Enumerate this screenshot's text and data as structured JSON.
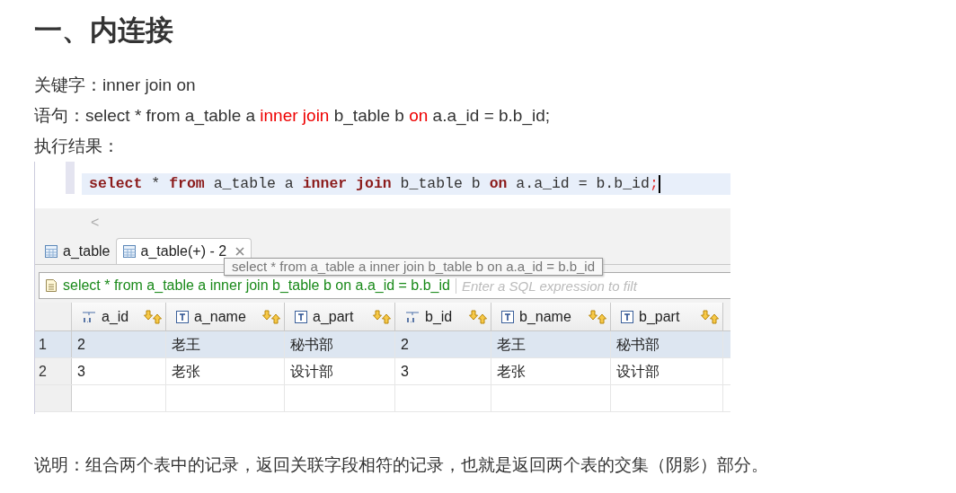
{
  "heading": "一、内连接",
  "keyword_line": {
    "label": "关键字：",
    "value": "inner join on"
  },
  "statement_line": {
    "label": "语句：",
    "segments": [
      {
        "text": "select * from a_table a ",
        "highlight": false
      },
      {
        "text": "inner join",
        "highlight": true
      },
      {
        "text": " b_table b ",
        "highlight": false
      },
      {
        "text": "on",
        "highlight": true
      },
      {
        "text": " a.a_id = b.b_id;",
        "highlight": false
      }
    ]
  },
  "result_label": "执行结果：",
  "editor": {
    "tokens": [
      {
        "text": "select",
        "kind": "keyword"
      },
      {
        "text": " * ",
        "kind": "plain"
      },
      {
        "text": "from",
        "kind": "keyword"
      },
      {
        "text": " a_table a ",
        "kind": "plain"
      },
      {
        "text": "inner join",
        "kind": "keyword"
      },
      {
        "text": " b_table b ",
        "kind": "plain"
      },
      {
        "text": "on",
        "kind": "keyword"
      },
      {
        "text": " a.a_id = b.b_id",
        "kind": "plain"
      },
      {
        "text": ";",
        "kind": "punct"
      }
    ],
    "scroll_arrow": "<"
  },
  "tabs": [
    {
      "label": "a_table",
      "selected": false,
      "closable": false
    },
    {
      "label": "a_table(+) - 2",
      "selected": true,
      "closable": true
    }
  ],
  "tooltip": "select * from a_table a inner join b_table b on a.a_id = b.b_id",
  "filter": {
    "value": "select * from a_table a inner join b_table b on a.a_id = b.b_id",
    "placeholder": "Enter a SQL expression to filt"
  },
  "table": {
    "columns": [
      {
        "name": "a_id",
        "kind": "number"
      },
      {
        "name": "a_name",
        "kind": "text"
      },
      {
        "name": "a_part",
        "kind": "text"
      },
      {
        "name": "b_id",
        "kind": "number"
      },
      {
        "name": "b_name",
        "kind": "text"
      },
      {
        "name": "b_part",
        "kind": "text"
      }
    ],
    "rows": [
      {
        "number": "1",
        "selected": true,
        "cells": [
          "2",
          "老王",
          "秘书部",
          "2",
          "老王",
          "秘书部"
        ]
      },
      {
        "number": "2",
        "selected": false,
        "cells": [
          "3",
          "老张",
          "设计部",
          "3",
          "老张",
          "设计部"
        ]
      }
    ]
  },
  "note": "说明：组合两个表中的记录，返回关联字段相符的记录，也就是返回两个表的交集（阴影）部分。"
}
